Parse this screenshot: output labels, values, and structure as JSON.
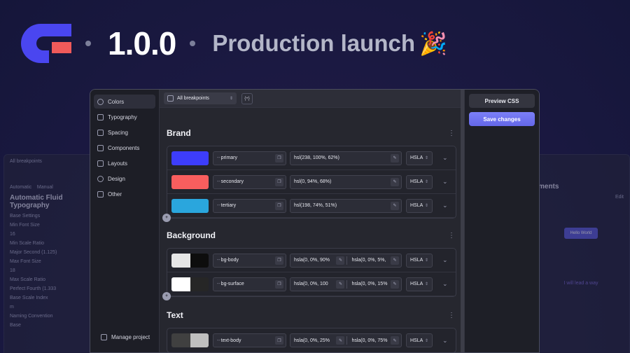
{
  "hero": {
    "version": "1.0.0",
    "tagline": "Production launch",
    "emoji": "🎉",
    "logo_colors": {
      "primary": "#4a46f0",
      "accent": "#f05a5a"
    }
  },
  "sidebar": {
    "items": [
      {
        "label": "Colors",
        "icon": "palette-icon"
      },
      {
        "label": "Typography",
        "icon": "typography-icon"
      },
      {
        "label": "Spacing",
        "icon": "spacing-icon"
      },
      {
        "label": "Components",
        "icon": "components-icon"
      },
      {
        "label": "Layouts",
        "icon": "layouts-icon"
      },
      {
        "label": "Design",
        "icon": "design-icon"
      },
      {
        "label": "Other",
        "icon": "other-icon"
      }
    ],
    "manage_label": "Manage project"
  },
  "toolbar": {
    "breakpoint_select": "All breakpoints",
    "brace_button": "{+}"
  },
  "actions": {
    "preview_label": "Preview CSS",
    "save_label": "Save changes"
  },
  "sections": {
    "brand": {
      "title": "Brand",
      "rows": [
        {
          "prefix": "--",
          "name": "primary",
          "value": "hsl(238, 100%, 62%)",
          "format": "HSLA",
          "swatch": [
            "#3d3dfb"
          ]
        },
        {
          "prefix": "--",
          "name": "secondary",
          "value": "hsl(0, 94%, 68%)",
          "format": "HSLA",
          "swatch": [
            "#f95e5e"
          ]
        },
        {
          "prefix": "--",
          "name": "tertiary",
          "value": "hsl(198, 74%, 51%)",
          "format": "HSLA",
          "swatch": [
            "#2aa6dd"
          ]
        }
      ]
    },
    "background": {
      "title": "Background",
      "rows": [
        {
          "prefix": "--",
          "name": "bg-body",
          "value_light": "hsla(0, 0%, 90%",
          "value_dark": "hsla(0, 0%, 5%,",
          "format": "HSLA",
          "swatch": [
            "#e6e6e6",
            "#0d0d0d"
          ]
        },
        {
          "prefix": "--",
          "name": "bg-surface",
          "value_light": "hsla(0, 0%, 100",
          "value_dark": "hsla(0, 0%, 15%",
          "format": "HSLA",
          "swatch": [
            "#ffffff",
            "#262626"
          ]
        }
      ]
    },
    "text": {
      "title": "Text",
      "rows": [
        {
          "prefix": "--",
          "name": "text-body",
          "value_light": "hsla(0, 0%, 25%",
          "value_dark": "hsla(0, 0%, 75%",
          "format": "HSLA",
          "swatch": [
            "#404040",
            "#bfbfbf"
          ]
        }
      ]
    }
  },
  "background_left": {
    "breakpoint": "All breakpoints",
    "tabs": [
      "Automatic",
      "Manual"
    ],
    "title": "Automatic Fluid Typography",
    "base_settings": "Base Settings",
    "min_font_size_label": "Min Font Size",
    "min_font_size": "16",
    "min_scale_label": "Min Scale Ratio",
    "min_scale": "Major Second (1.125)",
    "max_font_size_label": "Max Font Size",
    "max_font_size": "18",
    "max_scale_label": "Max Scale Ratio",
    "max_scale": "Perfect Fourth (1.333",
    "base_scale_label": "Base Scale Index",
    "base_scale": "m",
    "naming_label": "Naming Convention",
    "badge": "Base"
  },
  "background_right": {
    "title": "ments",
    "edit": "Edit",
    "hello": "Hello World",
    "lead": "I will lead a way"
  }
}
